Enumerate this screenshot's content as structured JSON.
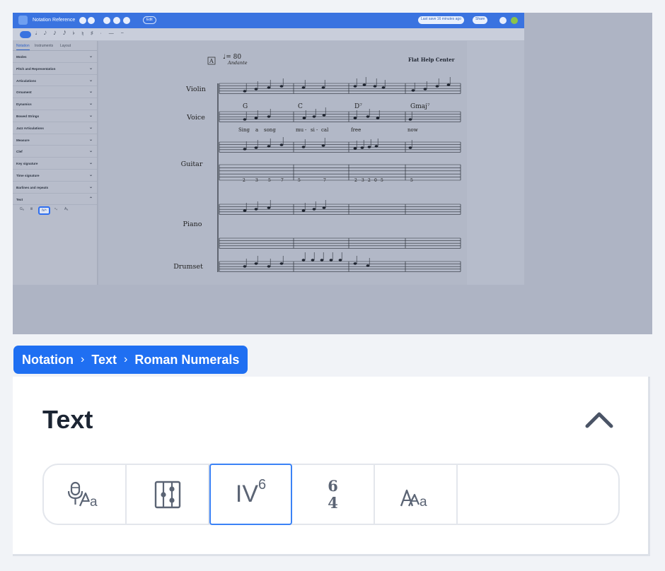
{
  "app": {
    "title": "Notation Reference",
    "edit_label": "Edit",
    "last_save": "Last save 16 minutes ago",
    "share_label": "Share",
    "help_center": "Flat Help Center",
    "toolbar_glyphs": "𝅘𝅥 𝅘𝅥𝅮 𝅘𝅥𝅯 𝅘𝅥𝅰 ♭ ♮ ♯ · — ~"
  },
  "panel": {
    "tabs": [
      "Notation",
      "Instruments",
      "Layout"
    ],
    "categories": [
      "Modes",
      "Pitch and Representation",
      "Articulations",
      "Ornament",
      "Dynamics",
      "Bowed Strings",
      "Jazz Articulations",
      "Measure",
      "Clef",
      "Key signature",
      "Time signature",
      "Barlines and repeats",
      "Text"
    ],
    "mini_tools": [
      "Gₐ",
      "Ⅲ",
      "Ⅳ⁶",
      "⁶₄",
      "Aₐ"
    ]
  },
  "score": {
    "rehearsal_mark": "A",
    "tempo": "♩= 80",
    "tempo_text": "Andante",
    "instruments": [
      "Violin",
      "Voice",
      "Guitar",
      "Piano",
      "Drumset"
    ],
    "chords": [
      "G",
      "C",
      "D⁷",
      "Gmaj⁷"
    ],
    "lyrics": [
      "Sing",
      "a",
      "song",
      "mu",
      "-",
      "si",
      "-",
      "cal",
      "free",
      "now"
    ],
    "tab_numbers": [
      "2",
      "3",
      "5",
      "7",
      "5",
      "7",
      "2",
      "3",
      "2",
      "0",
      "5",
      "5"
    ]
  },
  "breadcrumb": {
    "items": [
      "Notation",
      "Text",
      "Roman Numerals"
    ],
    "separator": "›"
  },
  "section": {
    "title": "Text",
    "collapse_icon": "chevron-up-icon",
    "tools": [
      {
        "name": "lyrics-tool",
        "icon": "microphone-text-icon"
      },
      {
        "name": "fretboard-tool",
        "icon": "chord-grid-icon"
      },
      {
        "name": "roman-numeral-tool",
        "label_main": "IV",
        "label_sup": "6"
      },
      {
        "name": "figured-bass-tool",
        "top": "6",
        "bottom": "4"
      },
      {
        "name": "text-tool",
        "icon": "text-aa-icon"
      }
    ]
  },
  "colors": {
    "accent": "#1f6ff2",
    "app_bar": "#3a73e0",
    "selection": "#3b82f6"
  }
}
